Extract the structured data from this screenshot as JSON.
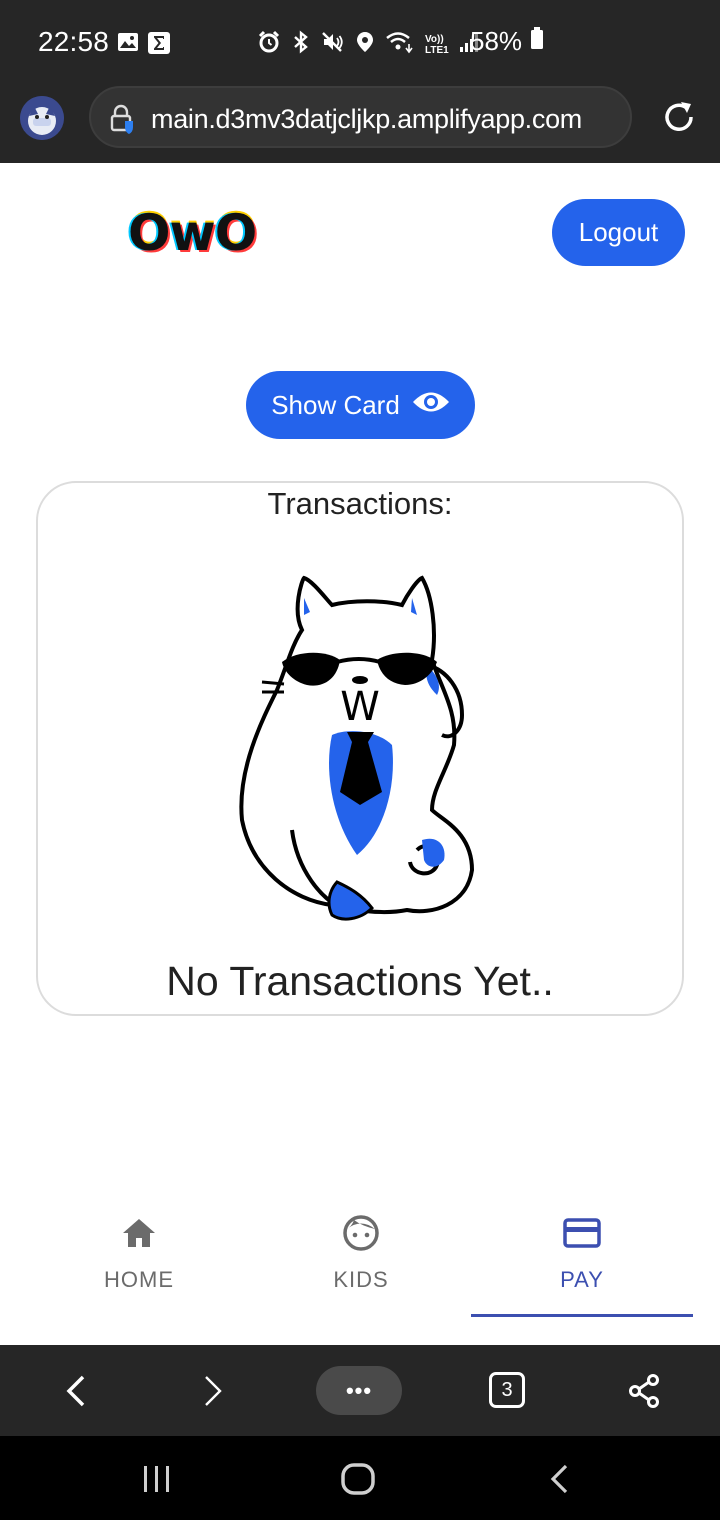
{
  "status_bar": {
    "time": "22:58",
    "battery": "58%",
    "icons": [
      "gallery-icon",
      "sigma-icon",
      "alarm-icon",
      "bluetooth-icon",
      "mute-icon",
      "location-icon",
      "wifi-icon",
      "signal-icon",
      "battery-icon"
    ],
    "network_label_top": "Vo))",
    "network_label_bottom": "LTE1"
  },
  "browser": {
    "url": "main.d3mv3datjcljkp.amplifyapp.com",
    "tabs_count": "3",
    "more_label": "•••"
  },
  "header": {
    "logo_text": "OwO",
    "logout_label": "Logout"
  },
  "main": {
    "show_card_label": "Show Card",
    "transactions_title": "Transactions:",
    "cat_tag": "W",
    "empty_message": "No Transactions Yet.."
  },
  "bottom_nav": {
    "items": [
      {
        "label": "HOME",
        "icon": "home-icon",
        "active": false
      },
      {
        "label": "KIDS",
        "icon": "kid-face-icon",
        "active": false
      },
      {
        "label": "PAY",
        "icon": "credit-card-icon",
        "active": true
      }
    ]
  },
  "colors": {
    "accent": "#2463eb",
    "nav_active": "#3c4fb0",
    "chrome_bg": "#262626"
  }
}
